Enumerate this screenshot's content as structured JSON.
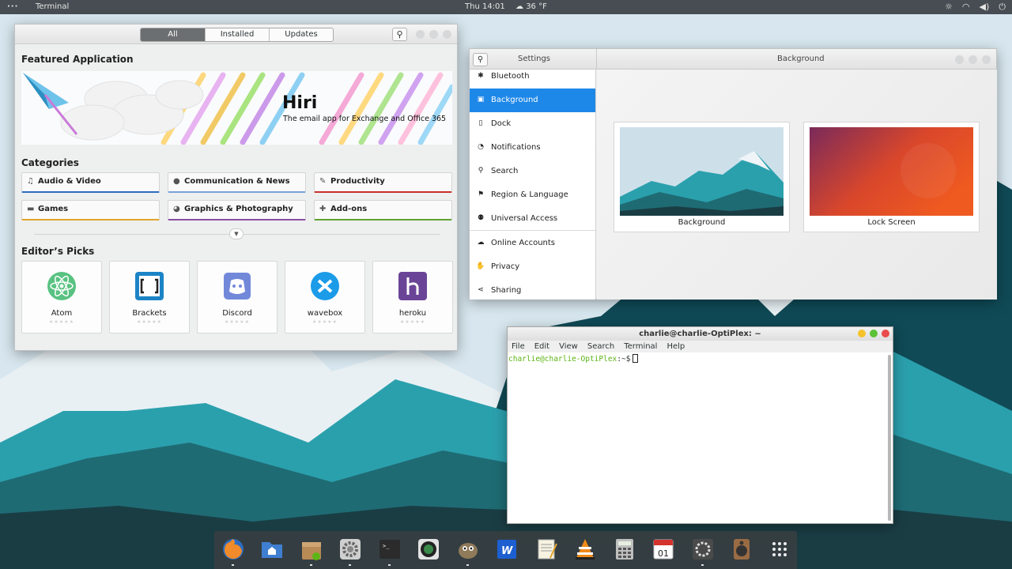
{
  "topbar": {
    "app_menu": "···",
    "active_app": "Terminal",
    "clock": "Thu 14:01",
    "weather": "36 °F",
    "weather_icon": "cloud-icon",
    "tray_icons": [
      "brightness-icon",
      "wifi-icon",
      "volume-icon",
      "power-icon"
    ]
  },
  "software": {
    "tabs": [
      {
        "label": "All",
        "active": true
      },
      {
        "label": "Installed",
        "active": false
      },
      {
        "label": "Updates",
        "active": false
      }
    ],
    "featured": {
      "heading": "Featured Application",
      "app_name": "Hiri",
      "app_desc": "The email app for Exchange and Office 365"
    },
    "categories_heading": "Categories",
    "categories": [
      {
        "label": "Audio & Video",
        "icon": "music-note-icon",
        "color": "#2d6cc0"
      },
      {
        "label": "Communication & News",
        "icon": "chat-icon",
        "color": "#7aa3d6"
      },
      {
        "label": "Productivity",
        "icon": "edit-icon",
        "color": "#c8302d"
      },
      {
        "label": "Games",
        "icon": "gamepad-icon",
        "color": "#e1a42b"
      },
      {
        "label": "Graphics & Photography",
        "icon": "palette-icon",
        "color": "#8a4da0"
      },
      {
        "label": "Add-ons",
        "icon": "puzzle-icon",
        "color": "#5ea32f"
      }
    ],
    "picks_heading": "Editor’s Picks",
    "picks": [
      {
        "name": "Atom",
        "stars": "★★★★★"
      },
      {
        "name": "Brackets",
        "stars": "★★★★★"
      },
      {
        "name": "Discord",
        "stars": "★★★★★"
      },
      {
        "name": "wavebox",
        "stars": "★★★★★"
      },
      {
        "name": "heroku",
        "stars": "★★★★★"
      }
    ]
  },
  "settings": {
    "sidebar_title": "Settings",
    "panel_title": "Background",
    "items": [
      {
        "label": "Bluetooth",
        "icon": "bluetooth-icon",
        "glyph": "✱",
        "selected": false
      },
      {
        "label": "Background",
        "icon": "display-icon",
        "glyph": "▣",
        "selected": true
      },
      {
        "label": "Dock",
        "icon": "dock-icon",
        "glyph": "▯",
        "selected": false
      },
      {
        "label": "Notifications",
        "icon": "bell-icon",
        "glyph": "◔",
        "selected": false
      },
      {
        "label": "Search",
        "icon": "search-icon",
        "glyph": "⚲",
        "selected": false
      },
      {
        "label": "Region & Language",
        "icon": "flag-icon",
        "glyph": "⚑",
        "selected": false
      },
      {
        "label": "Universal Access",
        "icon": "accessibility-icon",
        "glyph": "⚉",
        "selected": false
      },
      {
        "label": "Online Accounts",
        "icon": "cloud-icon",
        "glyph": "☁",
        "selected": false
      },
      {
        "label": "Privacy",
        "icon": "hand-icon",
        "glyph": "✋",
        "selected": false
      },
      {
        "label": "Sharing",
        "icon": "share-icon",
        "glyph": "⋖",
        "selected": false
      }
    ],
    "thumbs": [
      {
        "label": "Background"
      },
      {
        "label": "Lock Screen"
      }
    ],
    "accent": "#1e88e8"
  },
  "terminal": {
    "title": "charlie@charlie-OptiPlex: ~",
    "menu": [
      "File",
      "Edit",
      "View",
      "Search",
      "Terminal",
      "Help"
    ],
    "prompt_user": "charlie@charlie-OptiPlex",
    "prompt_rest": ":~$"
  },
  "dock": {
    "apps": [
      {
        "name": "firefox-icon",
        "running": true
      },
      {
        "name": "files-icon",
        "running": false
      },
      {
        "name": "software-center-icon",
        "running": true
      },
      {
        "name": "settings-gear-icon",
        "running": true
      },
      {
        "name": "terminal-icon",
        "running": true
      },
      {
        "name": "camera-app-icon",
        "running": false
      },
      {
        "name": "gimp-icon",
        "running": true
      },
      {
        "name": "word-processor-icon",
        "running": false
      },
      {
        "name": "text-editor-icon",
        "running": false
      },
      {
        "name": "vlc-icon",
        "running": false
      },
      {
        "name": "calculator-icon",
        "running": false
      },
      {
        "name": "calendar-icon",
        "running": false
      },
      {
        "name": "system-monitor-icon",
        "running": true
      },
      {
        "name": "speaker-icon",
        "running": false
      },
      {
        "name": "app-grid-icon",
        "running": false
      }
    ],
    "calendar_day": "01"
  }
}
